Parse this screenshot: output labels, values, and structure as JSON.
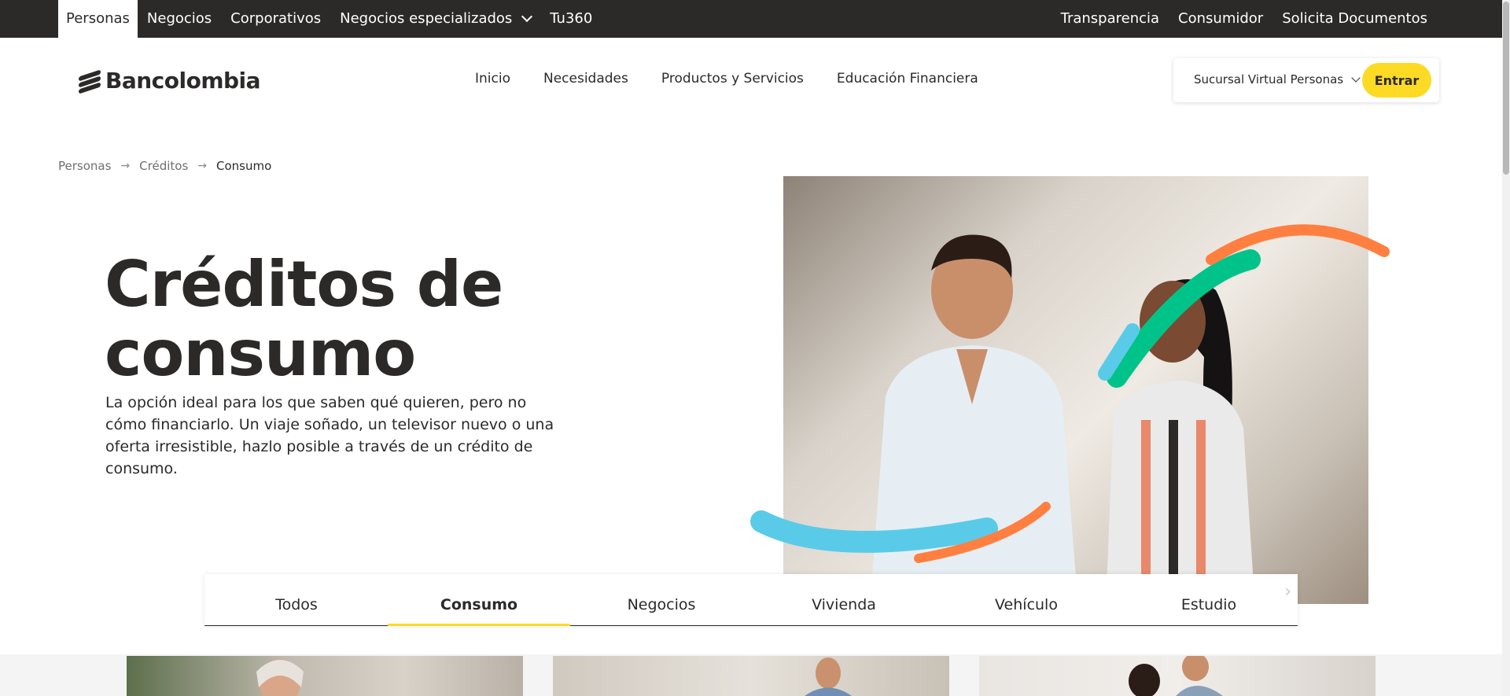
{
  "topbar": {
    "left": [
      {
        "label": "Personas"
      },
      {
        "label": "Negocios"
      },
      {
        "label": "Corporativos"
      },
      {
        "label": "Negocios especializados"
      },
      {
        "label": "Tu360"
      }
    ],
    "right": [
      {
        "label": "Transparencia"
      },
      {
        "label": "Consumidor"
      },
      {
        "label": "Solicita Documentos"
      }
    ]
  },
  "header": {
    "logo_text": "Bancolombia",
    "nav": [
      {
        "label": "Inicio"
      },
      {
        "label": "Necesidades"
      },
      {
        "label": "Productos y Servicios"
      },
      {
        "label": "Educación Financiera"
      }
    ],
    "sucursal_label": "Sucursal Virtual Personas",
    "entrar_label": "Entrar"
  },
  "breadcrumb": [
    {
      "label": "Personas"
    },
    {
      "label": "Créditos"
    },
    {
      "label": "Consumo"
    }
  ],
  "hero": {
    "title_line1": "Créditos de",
    "title_line2": "consumo",
    "description": "La opción ideal para los que saben qué quieren, pero no cómo financiarlo. Un viaje soñado, un televisor nuevo o una oferta irresistible, hazlo posible a través de un crédito de consumo."
  },
  "tabs": {
    "items": [
      {
        "label": "Todos"
      },
      {
        "label": "Consumo"
      },
      {
        "label": "Negocios"
      },
      {
        "label": "Vivienda"
      },
      {
        "label": "Vehículo"
      },
      {
        "label": "Estudio"
      }
    ],
    "active": "Consumo",
    "next_icon": "chevron-right-icon"
  },
  "colors": {
    "brand_dark": "#2c2a29",
    "brand_yellow": "#fdda24",
    "accent_green": "#00c389",
    "accent_orange": "#ff7f41",
    "accent_blue": "#59cbe8"
  }
}
